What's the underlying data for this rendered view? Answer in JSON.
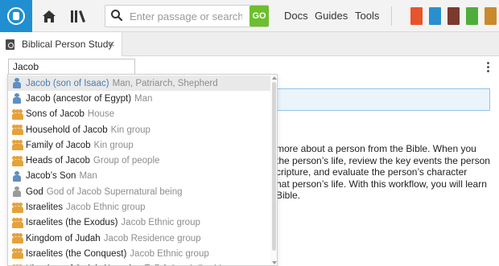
{
  "toolbar": {
    "search_placeholder": "Enter passage or search",
    "go_label": "GO",
    "nav": {
      "docs": "Docs",
      "guides": "Guides",
      "tools": "Tools"
    }
  },
  "tab": {
    "label": "Biblical Person Study",
    "close": "×"
  },
  "person_input": {
    "value": "Jacob"
  },
  "description": "more about a person from the Bible. When you the person’s life, review the key events the person cripture, and evaluate the person’s character hat person’s life. With this workflow, you will learn Bible.",
  "description_lines": [
    "more about a person from the Bible. When you",
    " the person’s life, review the key events the person",
    "cripture, and evaluate the person’s character",
    "hat person’s life. With this workflow, you will learn",
    "Bible."
  ],
  "dropdown": {
    "items": [
      {
        "icon": "person-icon",
        "name": "Jacob (son of Isaac)",
        "type": "Man, Patriarch, Shepherd",
        "selected": true
      },
      {
        "icon": "person-icon",
        "name": "Jacob (ancestor of Egypt)",
        "type": "Man"
      },
      {
        "icon": "group-icon",
        "name": "Sons of Jacob",
        "type": "House"
      },
      {
        "icon": "group-icon",
        "name": "Household of Jacob",
        "type": "Kin group"
      },
      {
        "icon": "group-icon",
        "name": "Family of Jacob",
        "type": "Kin group"
      },
      {
        "icon": "group-icon",
        "name": "Heads of Jacob",
        "type": "Group of people"
      },
      {
        "icon": "person-icon",
        "name": "Jacob’s Son",
        "type": "Man"
      },
      {
        "icon": "deity-icon",
        "name": "God",
        "type": "God of Jacob Supernatural being"
      },
      {
        "icon": "group-icon",
        "name": "Israelites",
        "type": "Jacob Ethnic group"
      },
      {
        "icon": "group-icon",
        "name": "Israelites (the Exodus)",
        "type": "Jacob Ethnic group"
      },
      {
        "icon": "group-icon",
        "name": "Kingdom of Judah",
        "type": "Jacob Residence group"
      },
      {
        "icon": "group-icon",
        "name": "Israelites (the Conquest)",
        "type": "Jacob Ethnic group"
      },
      {
        "icon": "group-icon",
        "name": "Kingdom of Judah (Assyrian Exile)",
        "type": "Jacob Residence group"
      }
    ]
  },
  "colors": {
    "logo": "#1f8fd1",
    "go": "#6cbf2d",
    "selected_name": "#4a7db5",
    "group_icon": "#e5a23a",
    "person_icon": "#5f8fc0"
  },
  "book_colors": [
    "#e8542b",
    "#2a8fcf",
    "#7a3b2e",
    "#4fae3b",
    "#c98a2c"
  ]
}
